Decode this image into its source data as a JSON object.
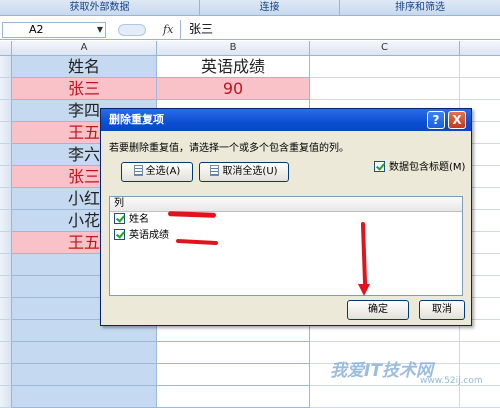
{
  "ribbon": {
    "groups": [
      "获取外部数据",
      "连接",
      "排序和筛选"
    ]
  },
  "formula_bar": {
    "name_box": "A2",
    "fx": "fx",
    "value": "张三"
  },
  "sheet": {
    "columns": [
      "A",
      "B",
      "C"
    ],
    "rows": [
      {
        "name": "姓名",
        "score": "英语成绩",
        "highlight": false
      },
      {
        "name": "张三",
        "score": "90",
        "highlight": true
      },
      {
        "name": "李四",
        "score": "",
        "highlight": false
      },
      {
        "name": "王五",
        "score": "",
        "highlight": true
      },
      {
        "name": "李六",
        "score": "",
        "highlight": false
      },
      {
        "name": "张三",
        "score": "",
        "highlight": true
      },
      {
        "name": "小红",
        "score": "",
        "highlight": false
      },
      {
        "name": "小花",
        "score": "",
        "highlight": false
      },
      {
        "name": "王五",
        "score": "",
        "highlight": true
      }
    ]
  },
  "dialog": {
    "title": "删除重复项",
    "help_symbol": "?",
    "close_symbol": "X",
    "instruction": "若要删除重复值，请选择一个或多个包含重复值的列。",
    "select_all": "全选(A)",
    "unselect_all": "取消全选(U)",
    "data_has_headers": "数据包含标题(M)",
    "list_header": "列",
    "columns": [
      "姓名",
      "英语成绩"
    ],
    "ok": "确定",
    "cancel": "取消"
  },
  "watermark": {
    "text": "我爱IT技术网",
    "url": "www.52ij.com"
  },
  "colors": {
    "pink_row": "#f9c2c8",
    "blue_col": "#c5d9f1",
    "title_bar": "#0b4fd3",
    "annotation": "#e0141e"
  }
}
